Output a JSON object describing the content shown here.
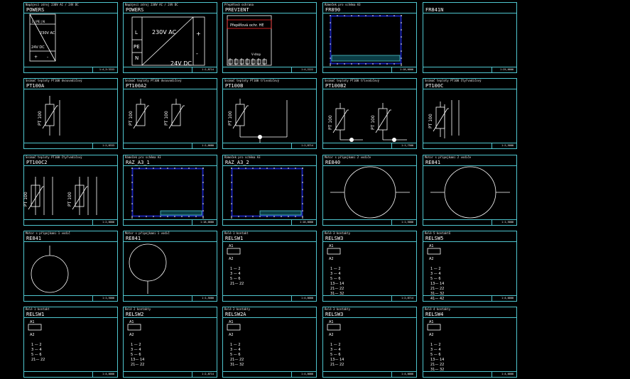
{
  "tiles": [
    {
      "id": "t1",
      "header": "Napájecí zdroj 230V AC / 24V DC",
      "name": "POWERS",
      "tag": "1:4,3:3333",
      "kind": "psu-small"
    },
    {
      "id": "t2",
      "header": "Napájecí zdroj 230V AC / 24V DC",
      "name": "POWERS",
      "tag": "1:2,8714",
      "kind": "psu-big"
    },
    {
      "id": "t3",
      "header": "Přepěťová ochrana",
      "name": "PREVIENT",
      "tag": "1:4,2222",
      "kind": "prevent"
    },
    {
      "id": "t4",
      "header": "Rámeček pro schéma A3",
      "name": "FR890",
      "tag": "1:18,0000",
      "kind": "frame-a"
    },
    {
      "id": "t5",
      "header": "",
      "name": "FR841N",
      "tag": "1:25,0000",
      "kind": "empty"
    },
    {
      "id": "t6",
      "header": "Snímač teploty PT100 dvouvodičový",
      "name": "PT100A",
      "tag": "1:2,8333",
      "kind": "pt-single"
    },
    {
      "id": "t7",
      "header": "Snímač teploty PT100 dvouvodičový",
      "name": "PT100A2",
      "tag": "1:2,0000",
      "kind": "pt-double"
    },
    {
      "id": "t8",
      "header": "Snímač teploty PT100 třívodičový",
      "name": "PT100B",
      "tag": "1:2,8714",
      "kind": "pt-three"
    },
    {
      "id": "t9",
      "header": "Snímač teploty PT100 třívodičový",
      "name": "PT100B2",
      "tag": "1:1,7500",
      "kind": "pt-three-double"
    },
    {
      "id": "t10",
      "header": "Snímač teploty PT100 čtyřvodičový",
      "name": "PT100C",
      "tag": "1:2,5000",
      "kind": "pt-four"
    },
    {
      "id": "t11",
      "header": "Snímač teploty PT100 čtyřvodičový",
      "name": "PT100C2",
      "tag": "1:2,0000",
      "kind": "pt-four-double"
    },
    {
      "id": "t12",
      "header": "Rámeček pro schéma A3",
      "name": "RAZ_A3_1",
      "tag": "1:18,0000",
      "kind": "frame-b"
    },
    {
      "id": "t13",
      "header": "Rámeček pro schéma A3",
      "name": "RAZ_A3_2",
      "tag": "1:18,0000",
      "kind": "frame-b"
    },
    {
      "id": "t14",
      "header": "Motor s přípojkami 2 vodiče",
      "name": "RE840",
      "tag": "1:1,5000",
      "kind": "motor-h"
    },
    {
      "id": "t15",
      "header": "Motor s přípojkami 2 vodiče",
      "name": "RE841",
      "tag": "1:1,5000",
      "kind": "motor-h"
    },
    {
      "id": "t16",
      "header": "Motor s přípojkami 1 vodič",
      "name": "RE841",
      "tag": "1:1,5000",
      "kind": "motor-top"
    },
    {
      "id": "t17",
      "header": "Motor s přípojkami 1 vodič",
      "name": "RE841",
      "tag": "1:1,5000",
      "kind": "motor-bottom"
    },
    {
      "id": "t18",
      "header": "Relé 1 kontakt",
      "name": "RELSW1",
      "tag": "1:4,0000",
      "kind": "relay",
      "pins": [
        "1 — 2",
        "3 — 4",
        "5 — 6",
        "21— 22"
      ]
    },
    {
      "id": "t19",
      "header": "Relé 3 kontakty",
      "name": "RELSW3",
      "tag": "1:2,8714",
      "kind": "relay",
      "pins": [
        "1 — 2",
        "3 — 4",
        "5 — 6",
        "13— 14",
        "21— 22",
        "31— 32"
      ]
    },
    {
      "id": "t20",
      "header": "Relé 5 kontaktů",
      "name": "RELSW5",
      "tag": "1:4,0000",
      "kind": "relay",
      "pins": [
        "1 — 2",
        "3 — 4",
        "5 — 6",
        "13— 14",
        "21— 22",
        "31— 32",
        "41— 42"
      ]
    },
    {
      "id": "t21",
      "header": "Relé 1 kontakt",
      "name": "RELSW1",
      "tag": "1:4,0000",
      "kind": "relay",
      "pins": [
        "1 — 2",
        "3 — 4",
        "5 — 6",
        "21— 22"
      ]
    },
    {
      "id": "t22",
      "header": "Relé 2 kontakty",
      "name": "RELSW2",
      "tag": "1:2,8714",
      "kind": "relay",
      "pins": [
        "1 — 2",
        "3 — 4",
        "5 — 6",
        "13— 14",
        "21— 22"
      ]
    },
    {
      "id": "t23",
      "header": "Relé 2 kontakty",
      "name": "RELSW2A",
      "tag": "1:4,0000",
      "kind": "relay",
      "pins": [
        "1 — 2",
        "3 — 4",
        "5 — 6",
        "21— 22",
        "31— 32"
      ]
    },
    {
      "id": "t24",
      "header": "Relé 3 kontakty",
      "name": "RELSW3",
      "tag": "1:4,0000",
      "kind": "relay",
      "pins": [
        "1 — 2",
        "3 — 4",
        "5 — 6",
        "13— 14",
        "21— 22"
      ]
    },
    {
      "id": "t25",
      "header": "Relé 4 kontakty",
      "name": "RELSW4",
      "tag": "1:4,0000",
      "kind": "relay",
      "pins": [
        "1 — 2",
        "3 — 4",
        "5 — 6",
        "13— 14",
        "21— 22",
        "31— 32"
      ]
    }
  ],
  "labels": {
    "ac": "230V AC",
    "dc": "24V DC",
    "pt": "PT 100",
    "L": "L",
    "PE": "PE",
    "N": "N",
    "plus": "+",
    "minus": "-",
    "prevent_text": "Přepěťová ochr. HE",
    "a1": "A1",
    "a2": "A2"
  },
  "colors": {
    "accent": "#4fc6cf",
    "blue": "#1f2bd8",
    "red": "#ff2a2a",
    "bg": "#000000",
    "line": "#ffffff"
  }
}
